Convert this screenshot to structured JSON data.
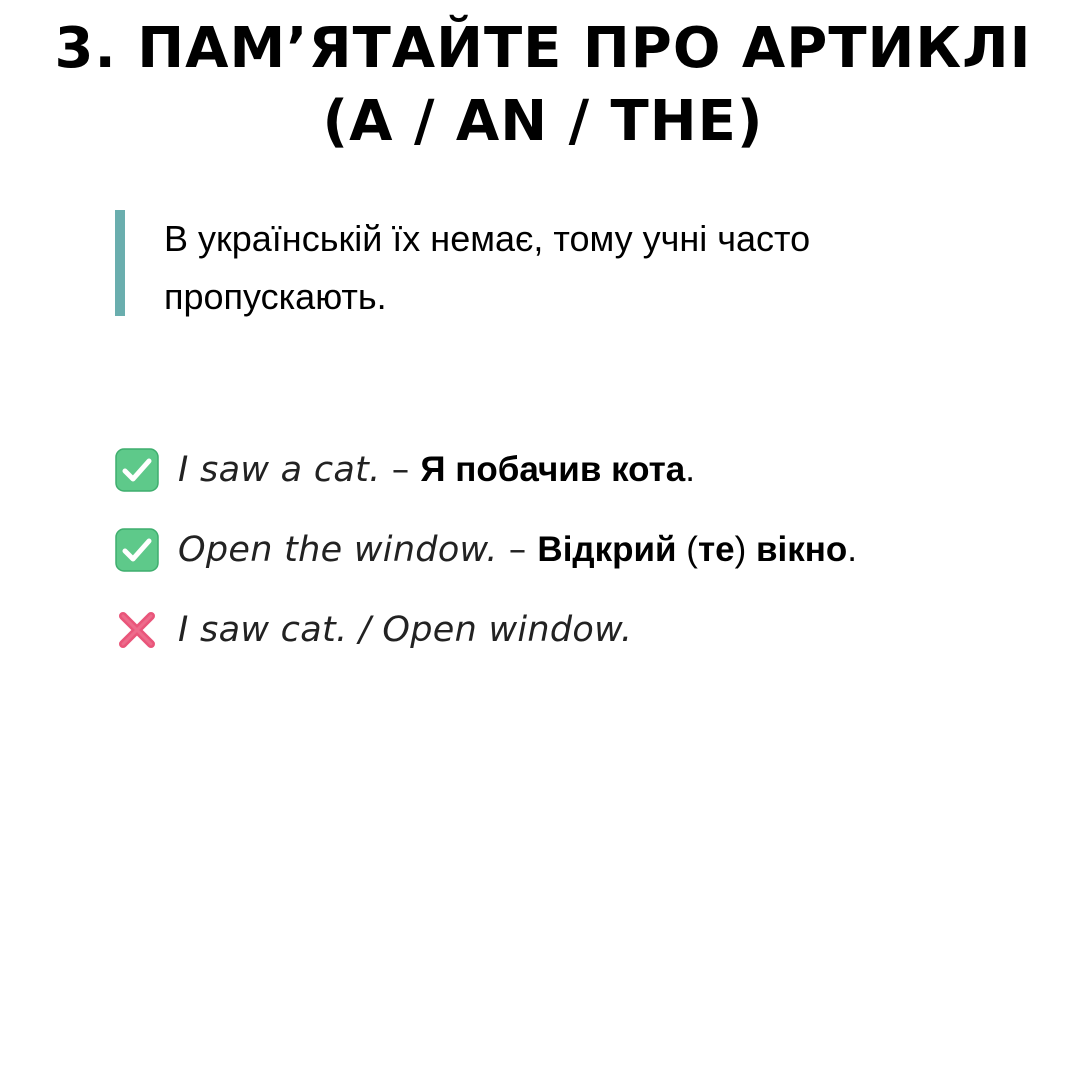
{
  "title": {
    "line1": "3. ПАМ’ЯТАЙТЕ ПРО АРТИКЛІ",
    "line2": "(A / AN / THE)"
  },
  "quote": {
    "line1": "В українській їх немає, тому учні часто",
    "line2": "пропускають.",
    "bar_color": "#6aaeae"
  },
  "examples": [
    {
      "icon": "check-mark-button-icon",
      "english": "I saw a cat.",
      "dash": " – ",
      "ukrainian_bold": "Я побачив кота",
      "tail": "."
    },
    {
      "icon": "check-mark-button-icon",
      "english": "Open the window.",
      "dash": " – ",
      "ukrainian_bold_1": "Відкрий",
      "ukrainian_normal": " (",
      "ukrainian_bold_2": "те",
      "ukrainian_normal_2": ") ",
      "ukrainian_bold_3": "вікно",
      "tail": "."
    },
    {
      "icon": "cross-mark-icon",
      "english": "I saw cat. / Open window."
    }
  ],
  "colors": {
    "check_green": "#5ec98a",
    "cross_pink": "#e9557a",
    "accent_teal": "#6aaeae"
  }
}
